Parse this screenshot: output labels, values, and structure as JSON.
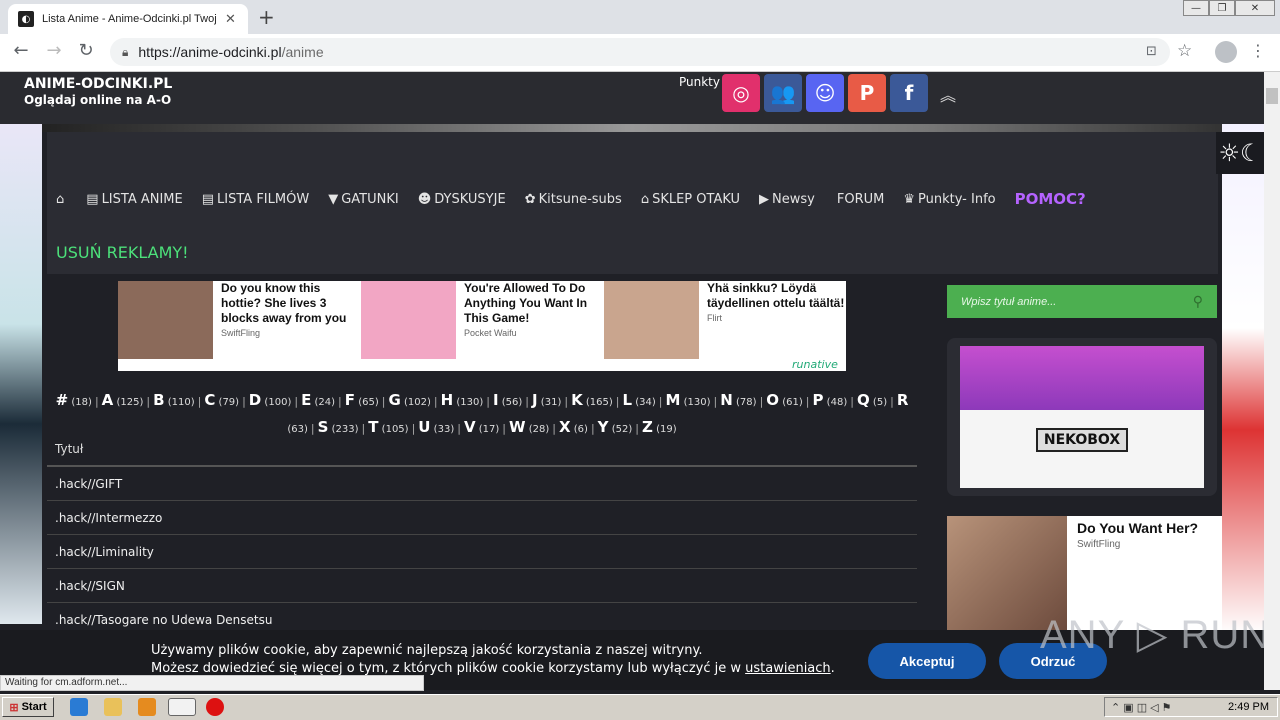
{
  "browser": {
    "tab_title": "Lista Anime - Anime-Odcinki.pl Twoja",
    "tab_close": "✕",
    "new_tab": "+",
    "url_main": "https://anime-odcinki.pl",
    "url_path": "/anime",
    "status": "Waiting for cm.adform.net...",
    "win_controls": [
      "—",
      "❐",
      "✕"
    ]
  },
  "site": {
    "logo_title": "ANIME-ODCINKI.PL",
    "logo_subtitle": "Oglądaj online na A-O",
    "punkty": "Punkty",
    "social": [
      {
        "name": "instagram",
        "glyph": "◎",
        "color": "#e1306c"
      },
      {
        "name": "group",
        "glyph": "👥",
        "color": "#3b5998"
      },
      {
        "name": "discord",
        "glyph": "☺",
        "color": "#5865f2"
      },
      {
        "name": "patreon",
        "glyph": "P",
        "color": "#e85b46"
      },
      {
        "name": "facebook",
        "glyph": "f",
        "color": "#3b5998"
      }
    ],
    "menu": [
      {
        "icon": "⌂",
        "label": ""
      },
      {
        "icon": "▤",
        "label": "LISTA ANIME"
      },
      {
        "icon": "▤",
        "label": "LISTA FILMÓW"
      },
      {
        "icon": "▼",
        "label": "GATUNKI"
      },
      {
        "icon": "☻",
        "label": "DYSKUSYJE"
      },
      {
        "icon": "✿",
        "label": "Kitsune-subs"
      },
      {
        "icon": "⌂",
        "label": "SKLEP OTAKU"
      },
      {
        "icon": "▶",
        "label": "Newsy"
      },
      {
        "icon": "",
        "label": "FORUM"
      },
      {
        "icon": "♛",
        "label": "Punkty- Info"
      }
    ],
    "pomoc": "POMOC?",
    "usun": "USUŃ REKLAMY!",
    "mode_icon": "☼☾"
  },
  "ads": [
    {
      "title": "Do you know this hottie? She lives 3 blocks away from you",
      "source": "SwiftFling",
      "color": "#8b6a5a"
    },
    {
      "title": "You're Allowed To Do Anything You Want In This Game!",
      "source": "Pocket Waifu",
      "color": "#f2a6c4"
    },
    {
      "title": "Yhä sinkku? Löydä täydellinen ottelu täältä!",
      "source": "Flirt",
      "color": "#c9a58e"
    }
  ],
  "ad_brand": "runative",
  "letters": [
    [
      "#",
      "18"
    ],
    [
      "A",
      "125"
    ],
    [
      "B",
      "110"
    ],
    [
      "C",
      "79"
    ],
    [
      "D",
      "100"
    ],
    [
      "E",
      "24"
    ],
    [
      "F",
      "65"
    ],
    [
      "G",
      "102"
    ],
    [
      "H",
      "130"
    ],
    [
      "I",
      "56"
    ],
    [
      "J",
      "31"
    ],
    [
      "K",
      "165"
    ],
    [
      "L",
      "34"
    ],
    [
      "M",
      "130"
    ],
    [
      "N",
      "78"
    ],
    [
      "O",
      "61"
    ],
    [
      "P",
      "48"
    ],
    [
      "Q",
      "5"
    ],
    [
      "R",
      "63"
    ],
    [
      "S",
      "233"
    ],
    [
      "T",
      "105"
    ],
    [
      "U",
      "33"
    ],
    [
      "V",
      "17"
    ],
    [
      "W",
      "28"
    ],
    [
      "X",
      "6"
    ],
    [
      "Y",
      "52"
    ],
    [
      "Z",
      "19"
    ]
  ],
  "table": {
    "header": "Tytuł",
    "rows": [
      ".hack//GIFT",
      ".hack//Intermezzo",
      ".hack//Liminality",
      ".hack//SIGN",
      ".hack//Tasogare no Udewa Densetsu"
    ]
  },
  "sidebar": {
    "search_placeholder": "Wpisz tytuł anime...",
    "nekobox": "NEKOBOX",
    "side_ad_title": "Do You Want Her?",
    "side_ad_source": "SwiftFling"
  },
  "cookie": {
    "line1": "Używamy plików cookie, aby zapewnić najlepszą jakość korzystania z naszej witryny.",
    "line2": "Możesz dowiedzieć się więcej o tym, z których plików cookie korzystamy lub wyłączyć je w ",
    "link": "ustawieniach",
    "accept": "Akceptuj",
    "reject": "Odrzuć"
  },
  "watermark": "ANY ▷ RUN",
  "taskbar": {
    "start": "Start",
    "time": "2:49 PM"
  }
}
